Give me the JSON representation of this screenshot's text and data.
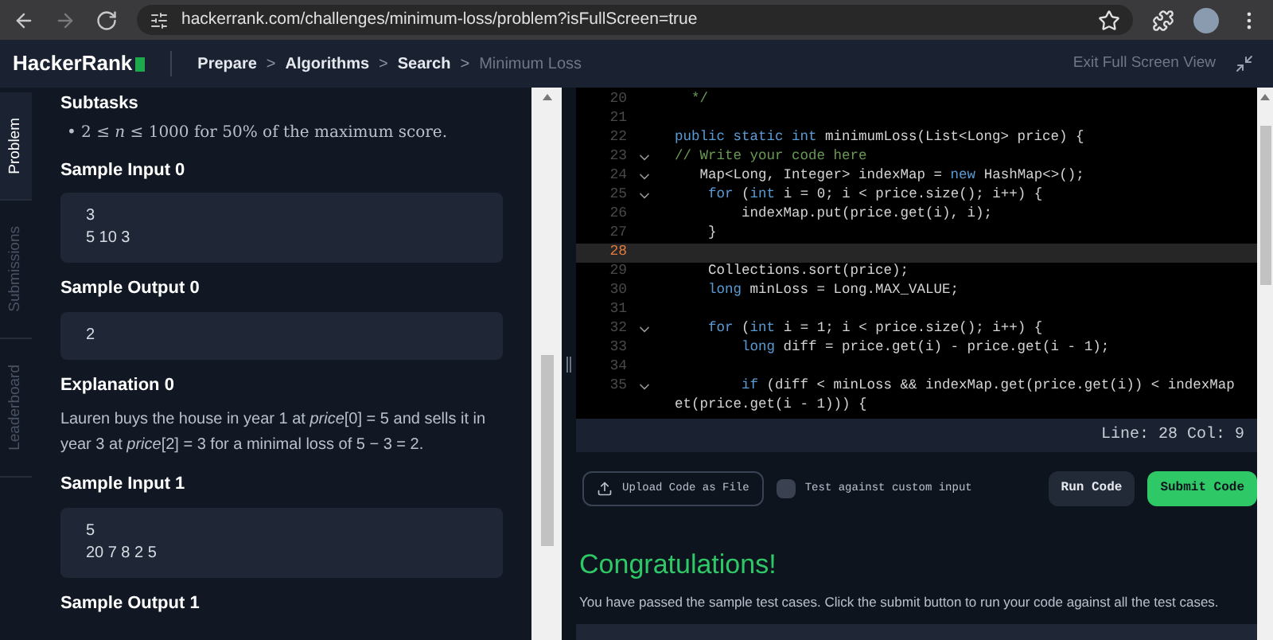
{
  "browser": {
    "url": "hackerrank.com/challenges/minimum-loss/problem?isFullScreen=true"
  },
  "header": {
    "logo": "HackerRank",
    "breadcrumbs": [
      {
        "label": "Prepare",
        "current": false
      },
      {
        "label": "Algorithms",
        "current": false
      },
      {
        "label": "Search",
        "current": false
      },
      {
        "label": "Minimum Loss",
        "current": true
      }
    ],
    "separator": ">",
    "exit_label": "Exit Full Screen View"
  },
  "side_tabs": [
    {
      "label": "Problem",
      "selected": true
    },
    {
      "label": "Submissions",
      "selected": false
    },
    {
      "label": "Leaderboard",
      "selected": false
    }
  ],
  "problem": [
    {
      "kind": "heading",
      "text": "Subtasks"
    },
    {
      "kind": "bullet",
      "marker": "•",
      "text": "2 ≤ *n* ≤ 1000 for 50% of the maximum score."
    },
    {
      "kind": "heading",
      "text": "Sample Input 0"
    },
    {
      "kind": "code",
      "lines": [
        "3",
        "5 10 3"
      ]
    },
    {
      "kind": "heading",
      "text": "Sample Output 0"
    },
    {
      "kind": "code",
      "lines": [
        "2"
      ]
    },
    {
      "kind": "heading",
      "text": "Explanation 0"
    },
    {
      "kind": "paragraph",
      "text": "Lauren buys the house in year 1 at *price*[0] = 5 and sells it in year 3 at *price*[2] = 3 for a minimal loss of 5 − 3 = 2."
    },
    {
      "kind": "heading",
      "text": "Sample Input 1"
    },
    {
      "kind": "code",
      "lines": [
        "5",
        "20 7 8 2 5"
      ]
    },
    {
      "kind": "heading",
      "text": "Sample Output 1"
    }
  ],
  "editor": {
    "lines": [
      {
        "number": "20",
        "fold": false,
        "current": false,
        "segments": [
          {
            "kind": "comment",
            "text": "  */"
          }
        ]
      },
      {
        "number": "21",
        "fold": false,
        "current": false
      },
      {
        "number": "22",
        "fold": false,
        "current": false,
        "segments": [
          {
            "kind": "keyword",
            "text": "public static int"
          },
          {
            "kind": "plain",
            "text": " minimumLoss(List<Long> price) {"
          }
        ]
      },
      {
        "number": "23",
        "fold": true,
        "current": false,
        "segments": [
          {
            "kind": "comment",
            "text": "// Write your code here"
          }
        ]
      },
      {
        "number": "24",
        "fold": true,
        "current": false,
        "segments": [
          {
            "kind": "plain",
            "text": "   Map<Long, Integer> indexMap = "
          },
          {
            "kind": "keyword",
            "text": "new"
          },
          {
            "kind": "plain",
            "text": " HashMap<>();"
          }
        ]
      },
      {
        "number": "25",
        "fold": true,
        "current": false,
        "segments": [
          {
            "kind": "keyword",
            "text": "    for"
          },
          {
            "kind": "plain",
            "text": " ("
          },
          {
            "kind": "keyword",
            "text": "int"
          },
          {
            "kind": "plain",
            "text": " i = 0; i < price.size(); i++) {"
          }
        ]
      },
      {
        "number": "26",
        "fold": false,
        "current": false,
        "segments": [
          {
            "kind": "plain",
            "text": "        indexMap.put(price.get(i), i);"
          }
        ]
      },
      {
        "number": "27",
        "fold": false,
        "current": false,
        "segments": [
          {
            "kind": "plain",
            "text": "    }"
          }
        ]
      },
      {
        "number": "28",
        "fold": false,
        "current": true
      },
      {
        "number": "29",
        "fold": false,
        "current": false,
        "segments": [
          {
            "kind": "plain",
            "text": "    Collections.sort(price);"
          }
        ]
      },
      {
        "number": "30",
        "fold": false,
        "current": false,
        "segments": [
          {
            "kind": "keyword",
            "text": "    long"
          },
          {
            "kind": "plain",
            "text": " minLoss = Long.MAX_VALUE;"
          }
        ]
      },
      {
        "number": "31",
        "fold": false,
        "current": false
      },
      {
        "number": "32",
        "fold": true,
        "current": false,
        "segments": [
          {
            "kind": "keyword",
            "text": "    for"
          },
          {
            "kind": "plain",
            "text": " ("
          },
          {
            "kind": "keyword",
            "text": "int"
          },
          {
            "kind": "plain",
            "text": " i = 1; i < price.size(); i++) {"
          }
        ]
      },
      {
        "number": "33",
        "fold": false,
        "current": false,
        "segments": [
          {
            "kind": "keyword",
            "text": "        long"
          },
          {
            "kind": "plain",
            "text": " diff = price.get(i) - price.get(i - 1);"
          }
        ]
      },
      {
        "number": "34",
        "fold": false,
        "current": false
      },
      {
        "number": "35",
        "fold": true,
        "current": false,
        "segments": [
          {
            "kind": "keyword",
            "text": "        if"
          },
          {
            "kind": "plain",
            "text": " (diff < minLoss && indexMap.get(price.get(i)) < indexMap"
          }
        ]
      },
      {
        "fold": false,
        "current": false,
        "segments": [
          {
            "kind": "plain",
            "text": "et(price.get(i - 1))) {"
          }
        ]
      }
    ],
    "status": "Line: 28 Col: 9"
  },
  "actions": {
    "upload": "Upload Code as File",
    "custom_input": {
      "label": "Test against custom input",
      "checked": false
    },
    "run": "Run Code",
    "submit": "Submit Code"
  },
  "result": {
    "title": "Congratulations!",
    "message": "You have passed the sample test cases. Click the submit button to run your code against all the test cases."
  }
}
